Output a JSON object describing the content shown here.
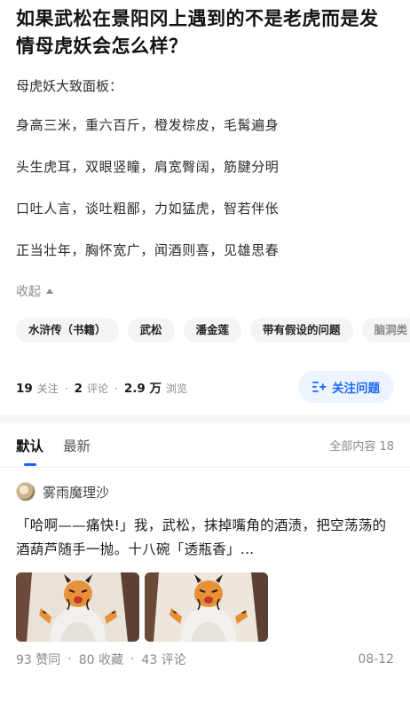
{
  "question": {
    "title": "如果武松在景阳冈上遇到的不是老虎而是发情母虎妖会怎么样？",
    "intro": "母虎妖大致面板：",
    "lines": [
      "身高三米，重六百斤，橙发棕皮，毛髯遍身",
      "头生虎耳，双眼竖瞳，肩宽臀阔，筋腱分明",
      "口吐人言，谈吐粗鄙，力如猛虎，智若伴伥",
      "正当壮年，胸怀宽广，闻酒则喜，见雄思春"
    ],
    "collapse_label": "收起",
    "tags": [
      "水浒传（书籍）",
      "武松",
      "潘金莲",
      "带有假设的问题",
      "脑洞类"
    ],
    "stats": {
      "followers": "19",
      "followers_label": "关注",
      "comments": "2",
      "comments_label": "评论",
      "views": "2.9 万",
      "views_label": "浏览"
    },
    "follow_button_label": "关注问题",
    "accent_color": "#1a66ff"
  },
  "sort": {
    "tabs": [
      "默认",
      "最新"
    ],
    "active_index": 0,
    "all_count_label": "全部内容 18"
  },
  "answer": {
    "author_name": "雾雨魔理沙",
    "text": "「哈啊——痛快!」我，武松，抹掉嘴角的酒渍，把空荡荡的酒葫芦随手一抛。十八碗「透瓶香」…",
    "thumbnails": [
      "tiger-girl-illustration",
      "tiger-girl-illustration"
    ],
    "likes": "93 赞同",
    "favorites": "80 收藏",
    "comments": "43 评论",
    "date": "08-12"
  }
}
